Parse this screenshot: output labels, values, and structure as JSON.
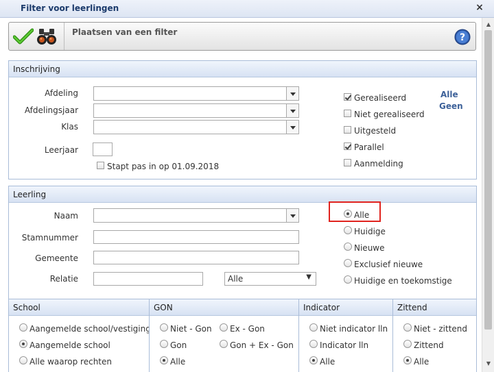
{
  "window": {
    "title": "Filter voor leerlingen",
    "close_label": "×"
  },
  "toolbar": {
    "title": "Plaatsen van een filter"
  },
  "inschrijving": {
    "header": "Inschrijving",
    "afdeling_label": "Afdeling",
    "afdelingsjaar_label": "Afdelingsjaar",
    "klas_label": "Klas",
    "leerjaar_label": "Leerjaar",
    "stapt_pas_label": "Stapt pas in op 01.09.2018",
    "status": [
      {
        "label": "Gerealiseerd",
        "checked": true
      },
      {
        "label": "Niet gerealiseerd",
        "checked": false
      },
      {
        "label": "Uitgesteld",
        "checked": false
      },
      {
        "label": "Parallel",
        "checked": true
      },
      {
        "label": "Aanmelding",
        "checked": false
      }
    ],
    "alle_link": "Alle",
    "geen_link": "Geen"
  },
  "leerling": {
    "header": "Leerling",
    "naam_label": "Naam",
    "stamnummer_label": "Stamnummer",
    "gemeente_label": "Gemeente",
    "relatie_label": "Relatie",
    "relatie_select": "Alle",
    "options": [
      {
        "label": "Alle",
        "selected": true
      },
      {
        "label": "Huidige",
        "selected": false
      },
      {
        "label": "Nieuwe",
        "selected": false
      },
      {
        "label": "Exclusief nieuwe",
        "selected": false
      },
      {
        "label": "Huidige en toekomstige",
        "selected": false
      }
    ]
  },
  "school": {
    "header": "School",
    "options": [
      "Aangemelde school/vestiging",
      "Aangemelde school",
      "Alle waarop rechten"
    ],
    "selected": 1
  },
  "gon": {
    "header": "GON",
    "options": [
      "Niet - Gon",
      "Ex - Gon",
      "Gon",
      "Gon + Ex - Gon",
      "Alle"
    ],
    "selected": 4
  },
  "indicator": {
    "header": "Indicator",
    "options": [
      "Niet indicator lln",
      "Indicator lln",
      "Alle"
    ],
    "selected": 2
  },
  "zittend": {
    "header": "Zittend",
    "options": [
      "Niet - zittend",
      "Zittend",
      "Alle"
    ],
    "selected": 2
  },
  "colors": {
    "accent": "#3d6199",
    "highlight": "#e0231e",
    "check_green": "#3aa41c"
  }
}
